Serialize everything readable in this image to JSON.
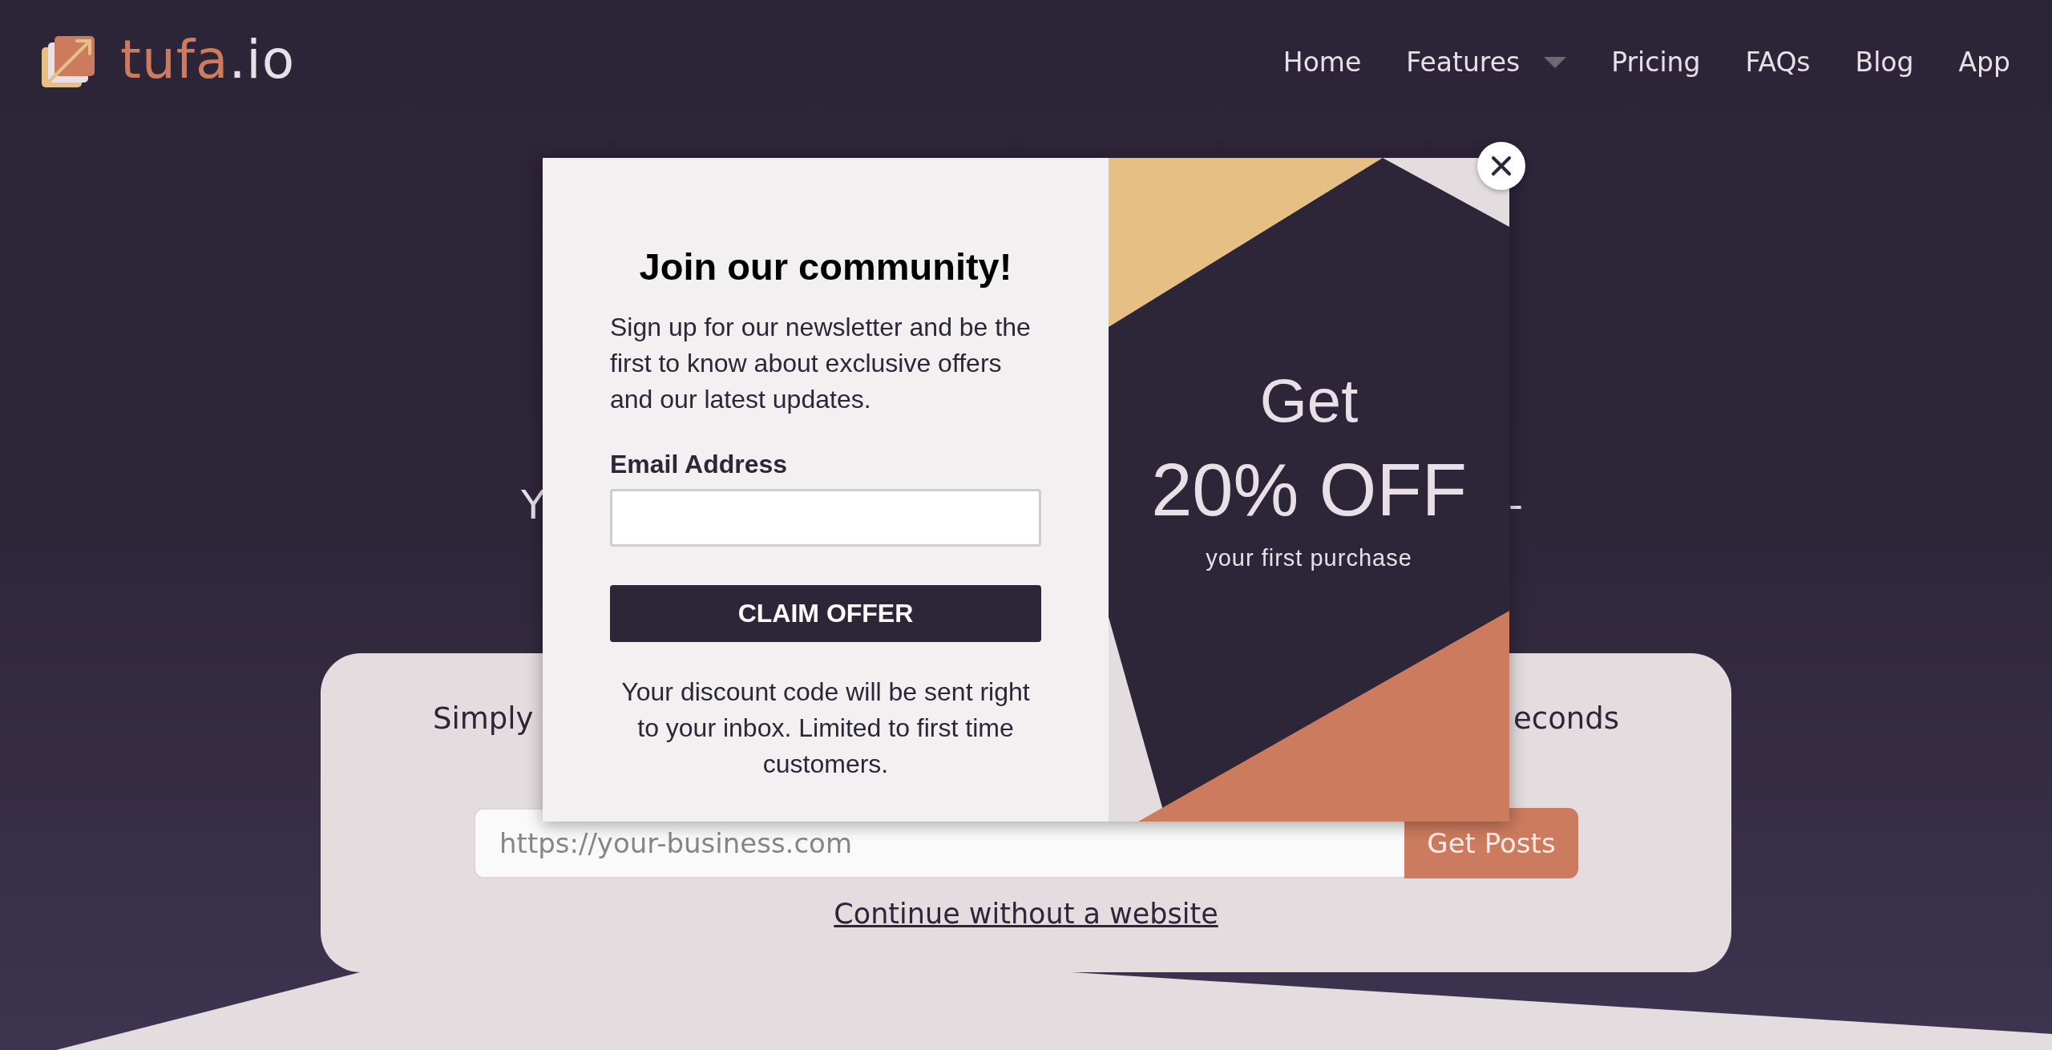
{
  "logo": {
    "name": "tufa",
    "suffix": ".io"
  },
  "nav": [
    {
      "label": "Home",
      "has_dropdown": false
    },
    {
      "label": "Features",
      "has_dropdown": true
    },
    {
      "label": "Pricing",
      "has_dropdown": false
    },
    {
      "label": "FAQs",
      "has_dropdown": false
    },
    {
      "label": "Blog",
      "has_dropdown": false
    },
    {
      "label": "App",
      "has_dropdown": false
    }
  ],
  "hero_fragments": [
    "Y",
    "-"
  ],
  "card": {
    "tagline_fragments": [
      "Simply",
      "econds"
    ],
    "url_field": {
      "placeholder": "https://your-business.com"
    },
    "submit_button": "Get Posts",
    "link": "Continue without a website"
  },
  "modal": {
    "title": "Join our community!",
    "intro": "Sign up for our newsletter and be the first to know about exclusive offers and our latest updates.",
    "email_label": "Email Address",
    "button": "CLAIM OFFER",
    "note": "Your discount code will be sent right to your inbox. Limited to first time customers.",
    "promo": {
      "lead": "Get",
      "headline": "20% OFF",
      "sub": "your first purchase"
    }
  }
}
